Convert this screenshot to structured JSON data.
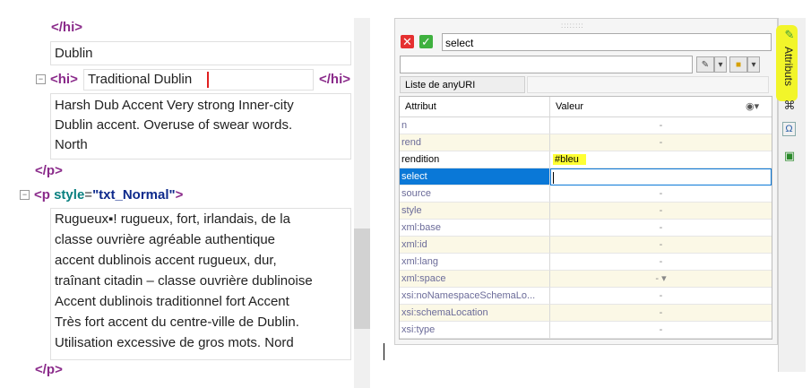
{
  "editor": {
    "hi_close": "</hi>",
    "dublin": "Dublin",
    "hi_open": "<hi>",
    "hi_text": "Traditional Dublin",
    "hi_close2": "</hi>",
    "para1_lines": [
      "Harsh Dub Accent Very strong Inner-city",
      "Dublin accent. Overuse of swear words.",
      "North"
    ],
    "p_close": "</p>",
    "p_open_start": "<p ",
    "p_attr": "style",
    "p_eq": "=",
    "p_val": "\"txt_Normal\"",
    "p_open_end": ">",
    "para2_lines": [
      "Rugueux▪! rugueux, fort, irlandais, de la",
      "classe ouvrière agréable authentique",
      "accent dublinois accent rugueux, dur,",
      "traînant citadin – classe ouvrière dublinoise",
      "Accent dublinois traditionnel fort Accent",
      "Très fort accent du centre-ville de Dublin.",
      "Utilisation excessive de gros mots. Nord"
    ],
    "p_close2": "</p>"
  },
  "panel": {
    "name_value": "select",
    "tab_label": "Liste de anyURI",
    "col_attr": "Attribut",
    "col_value": "Valeur",
    "rows": [
      {
        "name": "n",
        "value": "-"
      },
      {
        "name": "rend",
        "value": "-"
      },
      {
        "name": "rendition",
        "value": "#bleu"
      },
      {
        "name": "select",
        "value": ""
      },
      {
        "name": "source",
        "value": "-"
      },
      {
        "name": "style",
        "value": "-"
      },
      {
        "name": "xml:base",
        "value": "-"
      },
      {
        "name": "xml:id",
        "value": "-"
      },
      {
        "name": "xml:lang",
        "value": "-"
      },
      {
        "name": "xml:space",
        "value": "- ▾"
      },
      {
        "name": "xsi:noNamespaceSchemaLo...",
        "value": "-"
      },
      {
        "name": "xsi:schemaLocation",
        "value": "-"
      },
      {
        "name": "xsi:type",
        "value": "-"
      }
    ]
  },
  "side": {
    "label": "Attributs"
  }
}
